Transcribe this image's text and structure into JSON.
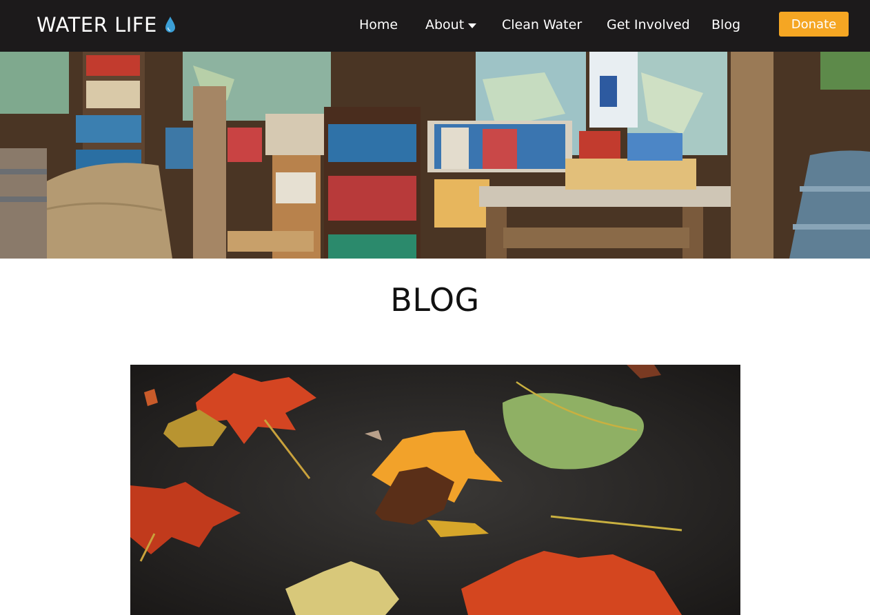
{
  "brand": {
    "name": "WATER LIFE",
    "icon": "water-drop-icon",
    "icon_color": "#3b9fd6"
  },
  "nav": {
    "items": [
      {
        "label": "Home"
      },
      {
        "label": "About",
        "has_dropdown": true
      },
      {
        "label": "Clean Water"
      },
      {
        "label": "Get Involved"
      },
      {
        "label": "Blog"
      }
    ],
    "donate_label": "Donate"
  },
  "page": {
    "title": "BLOG"
  },
  "colors": {
    "navbar_bg": "#1c1a1b",
    "accent": "#f5a623",
    "text": "#111111"
  }
}
